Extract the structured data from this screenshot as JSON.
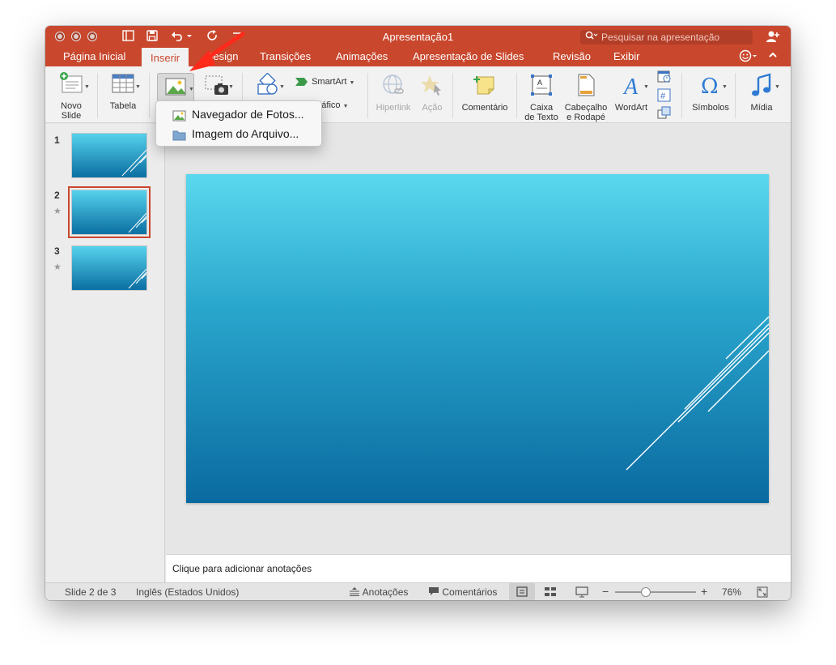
{
  "window": {
    "app_title": "Apresentação1",
    "search_placeholder": "Pesquisar na apresentação"
  },
  "tabs": [
    {
      "label": "Página Inicial"
    },
    {
      "label": "Inserir"
    },
    {
      "label": "Design"
    },
    {
      "label": "Transições"
    },
    {
      "label": "Animações"
    },
    {
      "label": "Apresentação de Slides"
    },
    {
      "label": "Revisão"
    },
    {
      "label": "Exibir"
    }
  ],
  "ribbon": {
    "novo_slide": [
      "Novo",
      "Slide"
    ],
    "tabela": "Tabela",
    "smartart": "SmartArt",
    "grafico": "Gráfico",
    "hiperlink": "Hiperlink",
    "acao": "Ação",
    "comentario": "Comentário",
    "caixa_texto": [
      "Caixa",
      "de Texto"
    ],
    "cabecalho": [
      "Cabeçalho",
      "e Rodapé"
    ],
    "wordart": "WordArt",
    "simbolos": "Símbolos",
    "midia": "Mídia"
  },
  "picture_menu": {
    "items": [
      {
        "label": "Navegador de Fotos..."
      },
      {
        "label": "Imagem do Arquivo..."
      }
    ]
  },
  "thumbnails": [
    {
      "number": "1",
      "selected": false,
      "animated": false
    },
    {
      "number": "2",
      "selected": true,
      "animated": true
    },
    {
      "number": "3",
      "selected": false,
      "animated": true
    }
  ],
  "notes_placeholder": "Clique para adicionar anotações",
  "status": {
    "slide": "Slide 2 de 3",
    "language": "Inglês (Estados Unidos)",
    "notes": "Anotações",
    "comments": "Comentários",
    "zoom": "76%",
    "zoom_fraction": 0.38
  },
  "colors": {
    "accent": "#c9472d",
    "arrow": "#ff2a1a",
    "slide_top": "#5ad8ee",
    "slide_bottom": "#0a6aa0"
  }
}
